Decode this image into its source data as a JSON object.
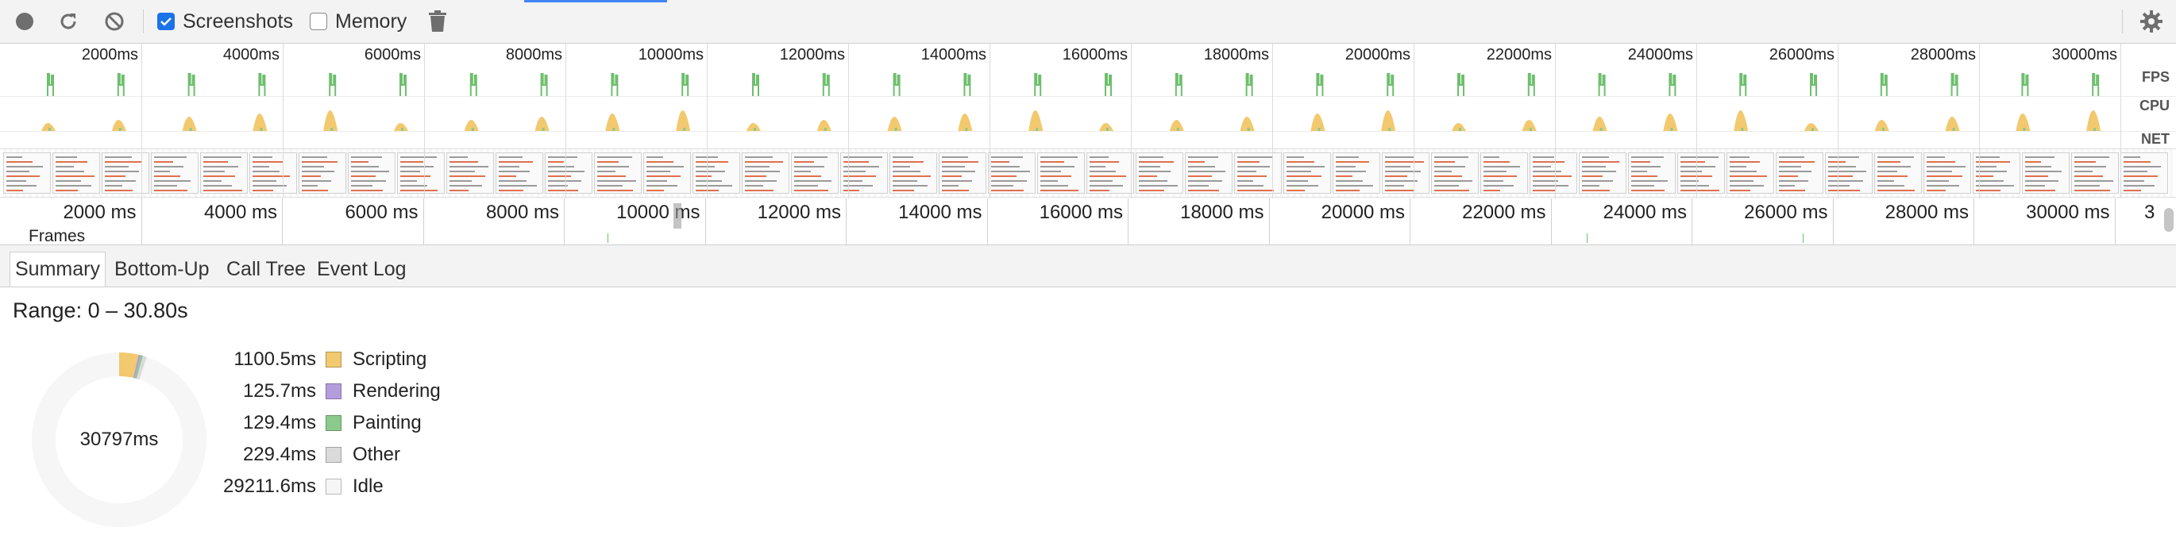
{
  "toolbar": {
    "record_icon": "record-icon",
    "reload_icon": "reload-icon",
    "clear_icon": "clear-icon",
    "screenshots_label": "Screenshots",
    "screenshots_checked": true,
    "memory_label": "Memory",
    "memory_checked": false,
    "trash_icon": "trash-icon",
    "settings_icon": "gear-icon"
  },
  "overview": {
    "time_labels": [
      "2000ms",
      "4000ms",
      "6000ms",
      "8000ms",
      "10000ms",
      "12000ms",
      "14000ms",
      "16000ms",
      "18000ms",
      "20000ms",
      "22000ms",
      "24000ms",
      "26000ms",
      "28000ms",
      "30000ms"
    ],
    "lanes": [
      "FPS",
      "CPU",
      "NET"
    ]
  },
  "ruler": {
    "labels": [
      "2000 ms",
      "4000 ms",
      "6000 ms",
      "8000 ms",
      "10000 ms",
      "12000 ms",
      "14000 ms",
      "16000 ms",
      "18000 ms",
      "20000 ms",
      "22000 ms",
      "24000 ms",
      "26000 ms",
      "28000 ms",
      "30000 ms",
      "3"
    ],
    "frames_label": "Frames"
  },
  "tabs": [
    {
      "label": "Summary",
      "active": true
    },
    {
      "label": "Bottom-Up",
      "active": false
    },
    {
      "label": "Call Tree",
      "active": false
    },
    {
      "label": "Event Log",
      "active": false
    }
  ],
  "summary": {
    "range": "Range: 0 – 30.80s",
    "total": "30797ms",
    "items": [
      {
        "value": "1100.5ms",
        "name": "Scripting",
        "color": "#f2c96e",
        "ms": 1100.5
      },
      {
        "value": "125.7ms",
        "name": "Rendering",
        "color": "#b39ddb",
        "ms": 125.7
      },
      {
        "value": "129.4ms",
        "name": "Painting",
        "color": "#8cc98c",
        "ms": 129.4
      },
      {
        "value": "229.4ms",
        "name": "Other",
        "color": "#dadada",
        "ms": 229.4
      },
      {
        "value": "29211.6ms",
        "name": "Idle",
        "color": "#f6f6f6",
        "ms": 29211.6
      }
    ]
  },
  "colors": {
    "accent": "#1a73e8",
    "fps": "#6dbf6d",
    "cpu_scripting": "#f2c96e",
    "cpu_rendering": "#b39ddb",
    "cpu_painting": "#8cc98c"
  }
}
